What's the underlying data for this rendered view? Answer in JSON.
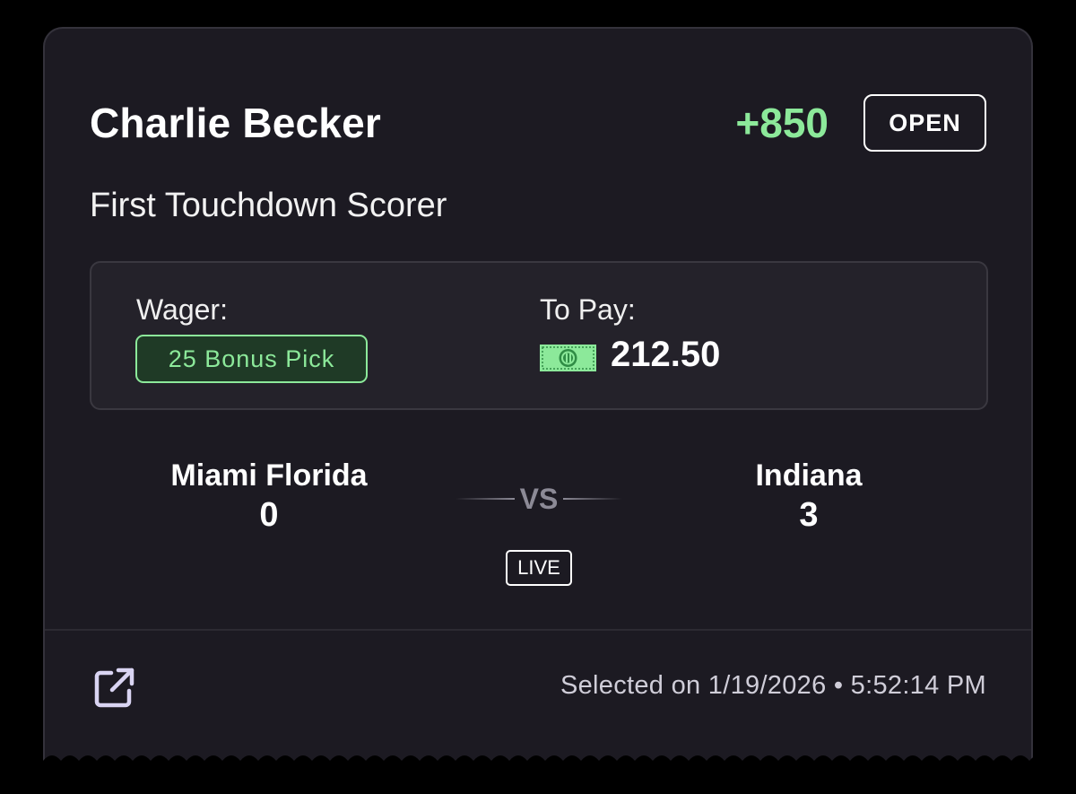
{
  "bet": {
    "player": "Charlie Becker",
    "odds": "+850",
    "status": "OPEN",
    "market": "First Touchdown Scorer"
  },
  "wager": {
    "label": "Wager:",
    "value": "25 Bonus Pick"
  },
  "payout": {
    "label": "To Pay:",
    "icon": "cash-icon",
    "value": "212.50"
  },
  "matchup": {
    "home_team": "Miami Florida",
    "home_score": "0",
    "vs": "VS",
    "away_team": "Indiana",
    "away_score": "3",
    "game_status": "LIVE"
  },
  "footer": {
    "share_icon": "external-link-icon",
    "selected_on": "Selected on 1/19/2026 • 5:52:14 PM"
  },
  "colors": {
    "background": "#000000",
    "card": "#1c1a22",
    "accent_green": "#8ce99a",
    "muted_text": "#cfcdd8"
  }
}
